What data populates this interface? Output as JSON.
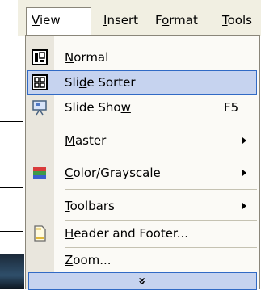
{
  "menubar": {
    "items": [
      {
        "label": "View",
        "mnemonic": "V",
        "rest": "iew",
        "active": true
      },
      {
        "label": "Insert",
        "mnemonic": "I",
        "rest": "nsert"
      },
      {
        "label": "Format",
        "pre": "F",
        "mnemonic": "o",
        "rest": "rmat"
      },
      {
        "label": "Tools",
        "mnemonic": "T",
        "rest": "ools"
      }
    ]
  },
  "view_menu": {
    "items": [
      {
        "label": "Normal",
        "pre": "",
        "mnemonic": "N",
        "rest": "ormal",
        "icon": "normal-view-icon"
      },
      {
        "label": "Slide Sorter",
        "pre": "Sli",
        "mnemonic": "d",
        "rest": "e Sorter",
        "icon": "slide-sorter-icon",
        "highlighted": true
      },
      {
        "label": "Slide Show",
        "pre": "Slide Sho",
        "mnemonic": "w",
        "rest": "",
        "icon": "slide-show-icon",
        "shortcut": "F5"
      },
      {
        "label": "Master",
        "pre": "",
        "mnemonic": "M",
        "rest": "aster",
        "submenu": true
      },
      {
        "label": "Color/Grayscale",
        "pre": "",
        "mnemonic": "C",
        "rest": "olor/Grayscale",
        "icon": "color-grayscale-icon",
        "submenu": true
      },
      {
        "label": "Toolbars",
        "pre": "",
        "mnemonic": "T",
        "rest": "oolbars",
        "submenu": true
      },
      {
        "label": "Header and Footer...",
        "pre": "",
        "mnemonic": "H",
        "rest": "eader and Footer...",
        "icon": "header-footer-icon"
      },
      {
        "label": "Zoom...",
        "pre": "",
        "mnemonic": "Z",
        "rest": "oom..."
      }
    ],
    "expand_glyph": "»"
  },
  "colors": {
    "highlight_bg": "#c6d3ef",
    "highlight_border": "#316ac5",
    "gutter": "#e9e6dd",
    "menubar": "#f1efe2"
  }
}
